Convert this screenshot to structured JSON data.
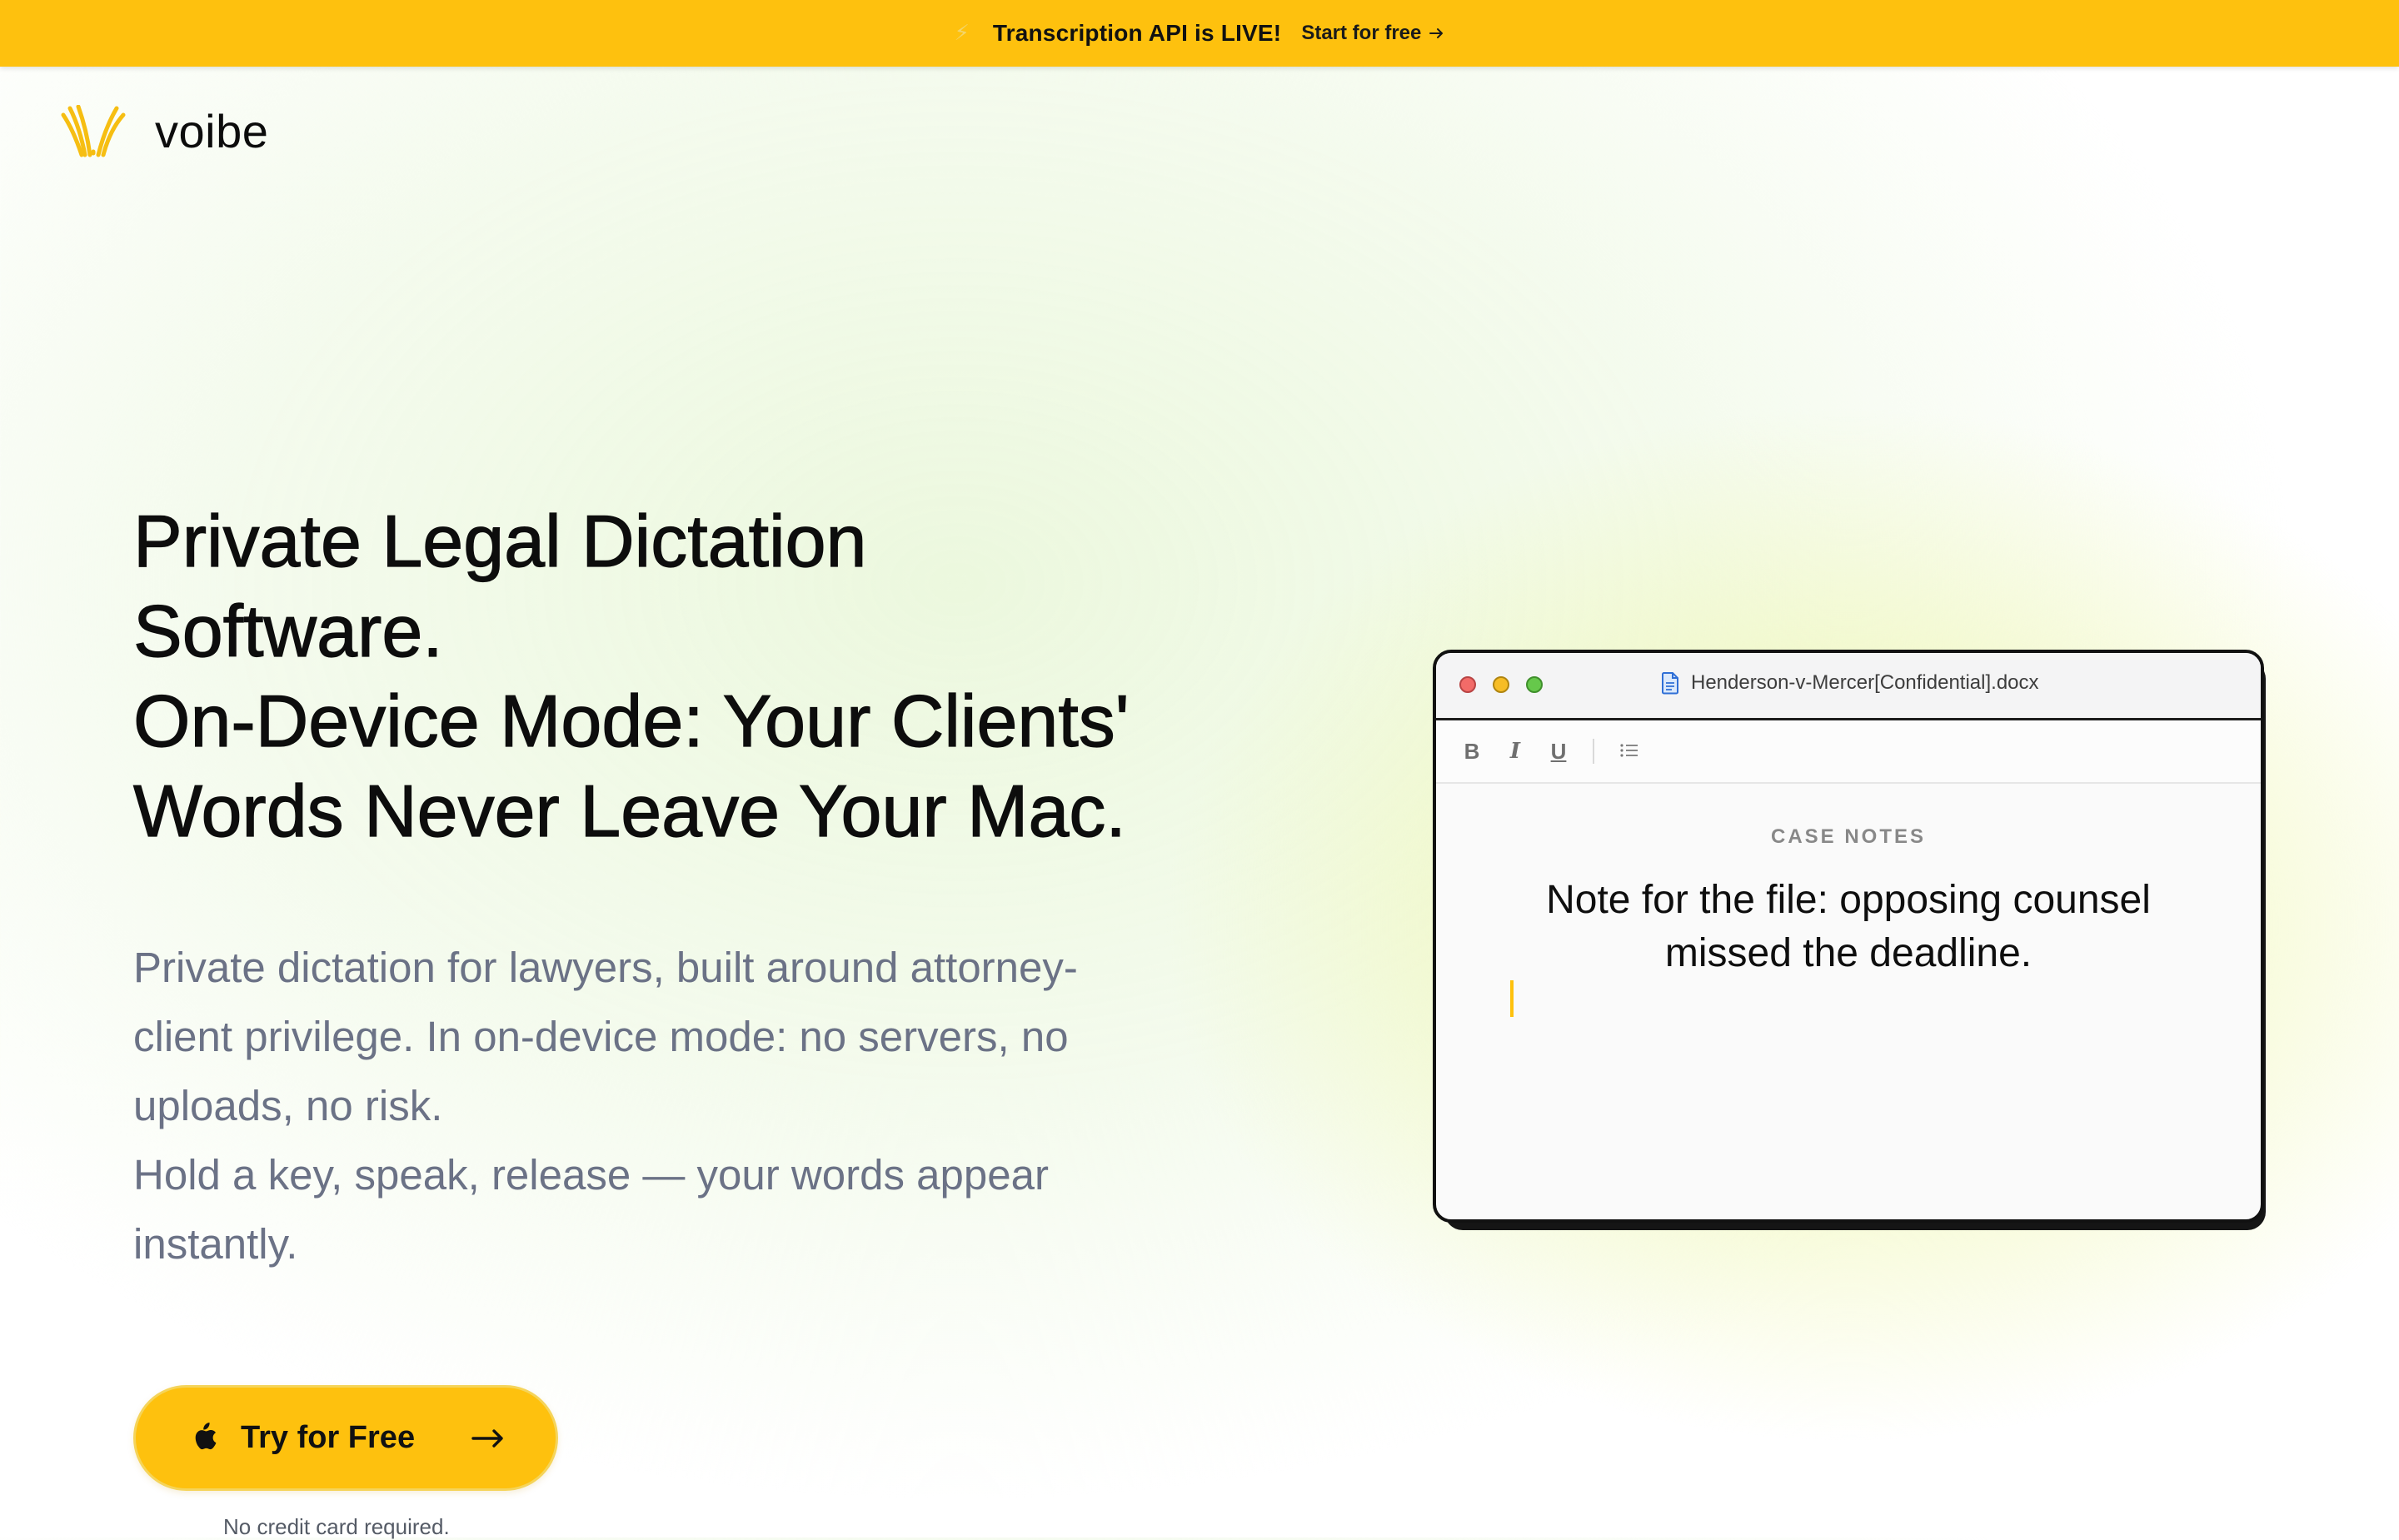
{
  "announcement": {
    "icon": "lightning-icon",
    "message": "Transcription API is LIVE!",
    "cta_label": "Start for free"
  },
  "brand": {
    "name": "voibe",
    "accent": "#FEC10E"
  },
  "hero": {
    "title_lines": [
      "Private Legal Dictation",
      "Software.",
      "On-Device Mode: Your Clients'",
      "Words Never Leave Your Mac."
    ],
    "subtitle_lines": [
      "Private dictation for lawyers, built around attorney-",
      "client privilege. In on-device mode: no servers, no",
      "uploads, no risk.",
      "Hold a key, speak, release — your words appear",
      "instantly."
    ],
    "cta_label": "Try for Free",
    "cta_note": "No credit card required."
  },
  "editor": {
    "filename": "Henderson-v-Mercer[Confidential].docx",
    "toolbar": {
      "bold": "B",
      "italic": "I",
      "underline": "U"
    },
    "section_label": "CASE NOTES",
    "note_lines": [
      "Note for the file: opposing counsel",
      "missed the deadline."
    ]
  }
}
